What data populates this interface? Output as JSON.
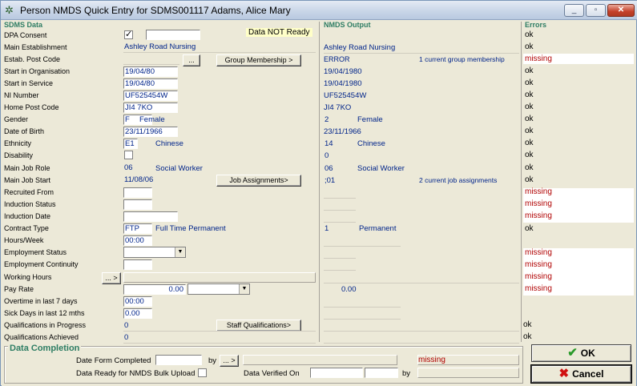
{
  "window": {
    "title": "Person NMDS Quick Entry for SDMS001117 Adams, Alice Mary",
    "minimize": "_",
    "maximize": "▫",
    "close": "✕"
  },
  "headers": {
    "sdms": "SDMS Data",
    "nmds": "NMDS Output",
    "errors": "Errors"
  },
  "data_status": "Data NOT Ready",
  "labels": {
    "dpa_consent": "DPA Consent",
    "main_establishment": "Main Establishment",
    "estab_post_code": "Estab. Post Code",
    "start_in_organisation": "Start in Organisation",
    "start_in_service": "Start in Service",
    "ni_number": "NI Number",
    "home_post_code": "Home Post Code",
    "gender": "Gender",
    "date_of_birth": "Date of Birth",
    "ethnicity": "Ethnicity",
    "disability": "Disability",
    "main_job_role": "Main Job Role",
    "main_job_start": "Main Job Start",
    "recruited_from": "Recruited From",
    "induction_status": "Induction Status",
    "induction_date": "Induction Date",
    "contract_type": "Contract Type",
    "hours_week": "Hours/Week",
    "employment_status": "Employment Status",
    "employment_continuity": "Employment Continuity",
    "working_hours": "Working Hours",
    "pay_rate": "Pay Rate",
    "overtime": "Overtime in last 7 days",
    "sick_days": "Sick Days in last 12 mths",
    "qual_in_progress": "Qualifications in Progress",
    "qual_achieved": "Qualifications Achieved"
  },
  "sdms": {
    "dpa_consent_checked": "✓",
    "main_establishment": "Ashley Road Nursing",
    "start_in_organisation": "19/04/80",
    "start_in_service": "19/04/80",
    "ni_number": "UF525454W",
    "home_post_code": "JI4 7KO",
    "gender_code": "F",
    "gender_text": "Female",
    "date_of_birth": "23/11/1966",
    "ethnicity_code": "E1",
    "ethnicity_text": "Chinese",
    "main_job_role_code": "06",
    "main_job_role_text": "Social Worker",
    "main_job_start": "11/08/06",
    "contract_type_code": "FTP",
    "contract_type_text": "Full Time Permanent",
    "hours_week": "00:00",
    "pay_rate": "0.00",
    "overtime": "00:00",
    "sick_days": "0.00",
    "qual_in_progress": "0",
    "qual_achieved": "0"
  },
  "buttons": {
    "estab_lookup": "...",
    "group_membership": "Group Membership >",
    "job_assignments": "Job Assignments>",
    "working_hours": "... >",
    "staff_qualifications": "Staff Qualifications>",
    "date_form_by": "... >",
    "ok": "OK",
    "cancel": "Cancel"
  },
  "nmds": {
    "main_establishment": "Ashley Road Nursing",
    "estab_post_code": "ERROR",
    "group_membership_note": "1 current group membership",
    "start_in_organisation": "19/04/1980",
    "start_in_service": "19/04/1980",
    "ni_number": "UF525454W",
    "home_post_code": "JI4 7KO",
    "gender_code": "2",
    "gender_text": "Female",
    "date_of_birth": "23/11/1966",
    "ethnicity_code": "14",
    "ethnicity_text": "Chinese",
    "disability": "0",
    "main_job_role_code": "06",
    "main_job_role_text": "Social Worker",
    "main_job_start": ";01",
    "job_assignments_note": "2 current job assignments",
    "contract_type_code": "1",
    "contract_type_text": "Permanent",
    "pay_rate": "0.00"
  },
  "errors": [
    "ok",
    "ok",
    "missing",
    "ok",
    "ok",
    "ok",
    "ok",
    "ok",
    "ok",
    "ok",
    "ok",
    "ok",
    "ok",
    "missing",
    "missing",
    "missing",
    "ok",
    "",
    "missing",
    "missing",
    "missing",
    "missing",
    "",
    "",
    "ok",
    "ok"
  ],
  "completion": {
    "title": "Data Completion",
    "date_form_completed": "Date Form Completed",
    "by": "by",
    "status": "missing",
    "data_ready_label": "Data Ready for NMDS Bulk Upload",
    "data_verified_on": "Data Verified On",
    "by2": "by"
  }
}
